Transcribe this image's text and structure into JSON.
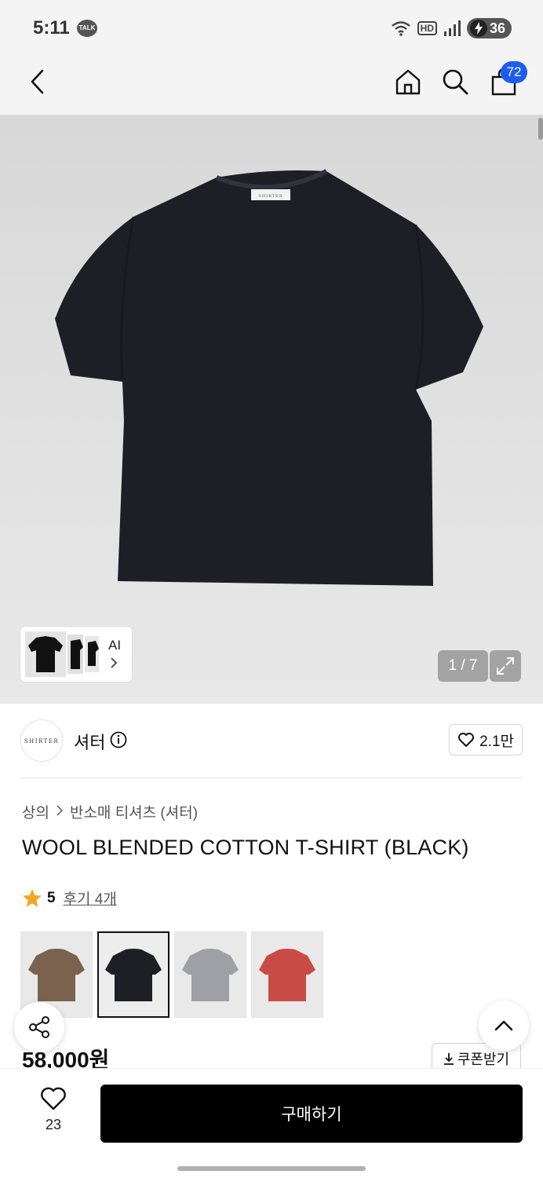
{
  "status_bar": {
    "time": "5:11",
    "talk_label": "TALK",
    "network_label": "HD",
    "battery_level": "36"
  },
  "nav": {
    "cart_count": "72"
  },
  "gallery": {
    "tshirt_label_text": "SHIRTER",
    "ai_label": "AI",
    "page_indicator": "1 / 7"
  },
  "brand": {
    "logo_text": "SHIRTER",
    "name": "셔터",
    "likes": "2.1만"
  },
  "product": {
    "breadcrumb": [
      "상의",
      "반소매 티셔츠 (셔터)"
    ],
    "title": "WOOL BLENDED COTTON T-SHIRT (BLACK)",
    "rating": "5",
    "review_link": "후기 4개",
    "swatches": [
      {
        "color": "#7a624e"
      },
      {
        "color": "#1d1f24"
      },
      {
        "color": "#9ea0a5"
      },
      {
        "color": "#c94b45"
      }
    ],
    "price": "58,000원",
    "coupon_label": "쿠폰받기"
  },
  "bottom_bar": {
    "wish_count": "23",
    "buy_label": "구매하기"
  }
}
